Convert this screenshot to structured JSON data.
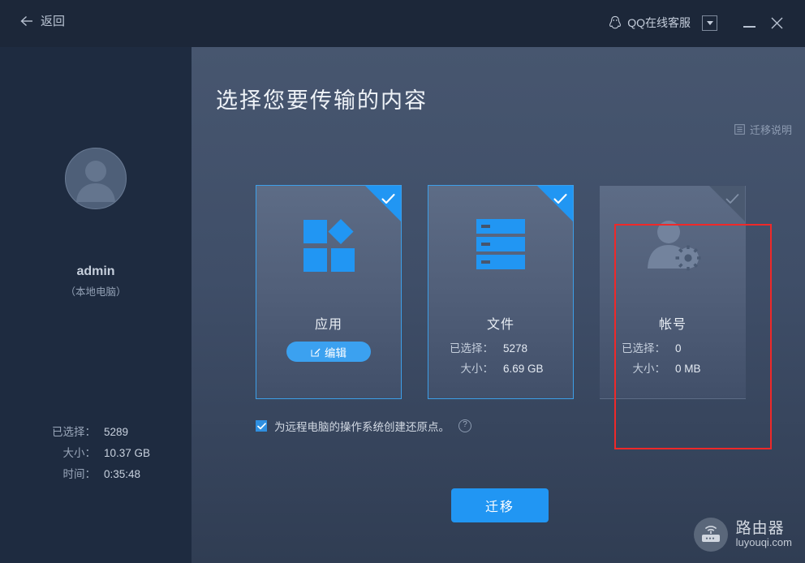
{
  "titlebar": {
    "back_label": "返回",
    "back_icon": "arrow-left-icon",
    "service_label": "QQ在线客服",
    "service_icon": "qq-penguin-icon",
    "dropdown_icon": "chevron-down-icon",
    "minimize_icon": "minimize-icon",
    "close_icon": "close-icon"
  },
  "sidebar": {
    "avatar_icon": "user-avatar-icon",
    "username": "admin",
    "user_desc": "（本地电脑）",
    "summary": [
      {
        "label": "已选择：",
        "value": "5289"
      },
      {
        "label": "大小：",
        "value": "10.37 GB"
      },
      {
        "label": "时间：",
        "value": "0:35:48"
      }
    ]
  },
  "main": {
    "page_title": "选择您要传输的内容",
    "migrate_help_label": "迁移说明",
    "migrate_help_icon": "document-list-icon",
    "cards": [
      {
        "id": "app",
        "title": "应用",
        "icon": "apps-tiles-icon",
        "selected": true,
        "check_icon": "check-icon",
        "edit_label": "编辑",
        "edit_icon": "pencil-square-icon"
      },
      {
        "id": "file",
        "title": "文件",
        "icon": "server-stack-icon",
        "selected": true,
        "check_icon": "check-icon",
        "stats": [
          {
            "label": "已选择：",
            "value": "5278"
          },
          {
            "label": "大小：",
            "value": "6.69 GB"
          }
        ]
      },
      {
        "id": "account",
        "title": "帐号",
        "icon": "user-gear-icon",
        "selected": false,
        "check_icon": "check-icon",
        "stats": [
          {
            "label": "已选择：",
            "value": "0"
          },
          {
            "label": "大小：",
            "value": "0 MB"
          }
        ]
      }
    ],
    "restore_point": {
      "checked": true,
      "label": "为远程电脑的操作系统创建还原点。",
      "help_icon": "question-mark-icon",
      "help_glyph": "?"
    },
    "migrate_button": "迁移"
  },
  "watermark": {
    "icon": "router-icon",
    "brand_cn": "路由器",
    "brand_en": "luyouqi.com"
  },
  "colors": {
    "accent_blue": "#2196f3",
    "highlight_red": "#ef2929",
    "titlebar_bg": "#1c2739",
    "sidebar_bg": "#1e2b40",
    "card_border_selected": "#3d9fe8"
  }
}
